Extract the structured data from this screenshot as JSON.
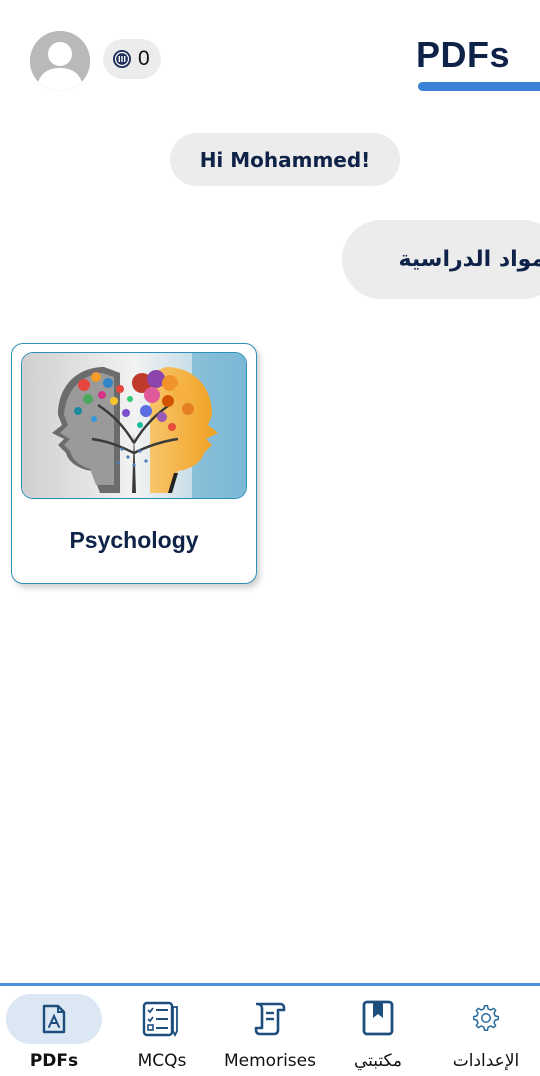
{
  "header": {
    "title": "PDFs",
    "coins": "0",
    "avatar_icon": "user-avatar-icon",
    "coin_icon": "coin-icon"
  },
  "greeting": "Hi Mohammed!",
  "section_heading": "المواد الدراسية",
  "subjects": [
    {
      "name": "Psychology",
      "image": "psychology-heads-illustration"
    }
  ],
  "bottom_nav": {
    "items": [
      {
        "label": "PDFs",
        "icon": "pdf-file-icon",
        "active": true
      },
      {
        "label": "MCQs",
        "icon": "checklist-icon",
        "active": false
      },
      {
        "label": "Memorises",
        "icon": "scroll-icon",
        "active": false
      },
      {
        "label": "مكتبتي",
        "icon": "bookmark-book-icon",
        "active": false
      },
      {
        "label": "الإعدادات",
        "icon": "gear-icon",
        "active": false
      }
    ]
  },
  "colors": {
    "primary_text": "#0f2349",
    "accent_blue": "#3b82d6",
    "pill_gray": "#ececec",
    "active_nav_bg": "#dbe8f3",
    "card_border": "#2e8fb8"
  }
}
